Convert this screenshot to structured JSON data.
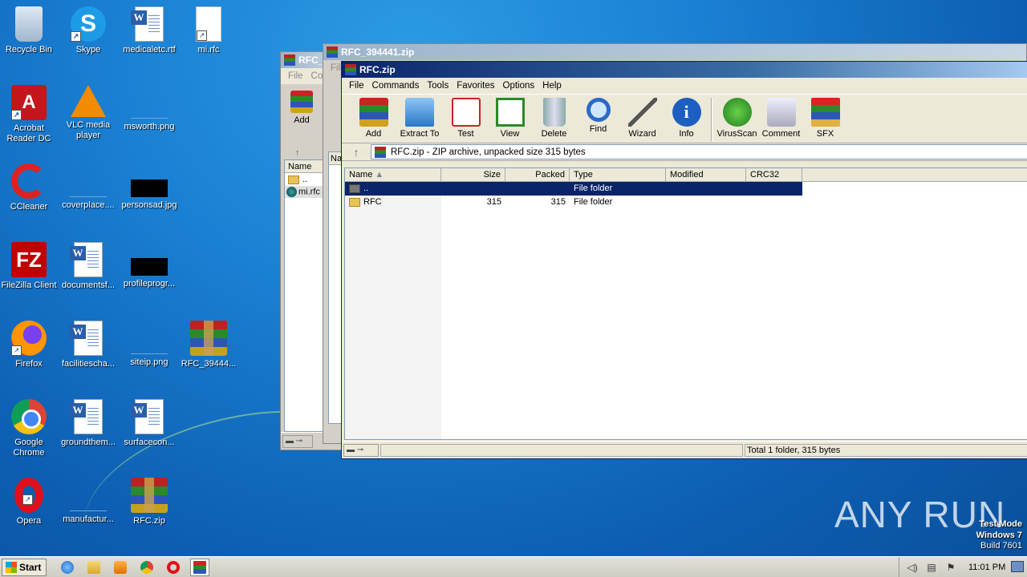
{
  "desktop": {
    "icons": [
      {
        "label": "Recycle Bin",
        "icon": "recycle-bin-icon"
      },
      {
        "label": "Skype",
        "icon": "skype-icon"
      },
      {
        "label": "medicaletc.rtf",
        "icon": "word-doc-icon"
      },
      {
        "label": "mi.rfc",
        "icon": "blank-file-icon"
      },
      {
        "label": "Acrobat Reader DC",
        "icon": "acrobat-icon"
      },
      {
        "label": "VLC media player",
        "icon": "vlc-icon"
      },
      {
        "label": "msworth.png",
        "icon": "png-file-icon"
      },
      {
        "label": "CCleaner",
        "icon": "ccleaner-icon"
      },
      {
        "label": "coverplace....",
        "icon": "png-file-icon"
      },
      {
        "label": "personsad.jpg",
        "icon": "jpg-file-icon"
      },
      {
        "label": "FileZilla Client",
        "icon": "filezilla-icon"
      },
      {
        "label": "documentsf...",
        "icon": "word-doc-icon"
      },
      {
        "label": "profileprogr...",
        "icon": "jpg-file-icon"
      },
      {
        "label": "Firefox",
        "icon": "firefox-icon"
      },
      {
        "label": "facilitiescha...",
        "icon": "word-doc-icon"
      },
      {
        "label": "siteip.png",
        "icon": "png-file-icon"
      },
      {
        "label": "RFC_39444...",
        "icon": "winrar-archive-icon"
      },
      {
        "label": "Google Chrome",
        "icon": "chrome-icon"
      },
      {
        "label": "groundthem...",
        "icon": "word-doc-icon"
      },
      {
        "label": "surfacecon...",
        "icon": "word-doc-icon"
      },
      {
        "label": "Opera",
        "icon": "opera-icon"
      },
      {
        "label": "manufactur...",
        "icon": "png-file-icon"
      },
      {
        "label": "RFC.zip",
        "icon": "winrar-archive-icon"
      }
    ]
  },
  "back_window_1": {
    "title": "RFC_...",
    "menu_file": "File",
    "menu_commands": "Co",
    "add_label": "Add",
    "col_name": "Name",
    "row_up": "..",
    "row_file": "mi.rfc"
  },
  "back_window_2": {
    "title": "RFC_394441.zip",
    "menu_file": "File",
    "col_name": "Na"
  },
  "main_window": {
    "title": "RFC.zip",
    "menu": [
      "File",
      "Commands",
      "Tools",
      "Favorites",
      "Options",
      "Help"
    ],
    "toolbar": [
      {
        "label": "Add",
        "icon": "add-archive-icon"
      },
      {
        "label": "Extract To",
        "icon": "extract-icon"
      },
      {
        "label": "Test",
        "icon": "test-icon"
      },
      {
        "label": "View",
        "icon": "view-icon"
      },
      {
        "label": "Delete",
        "icon": "delete-icon"
      },
      {
        "label": "Find",
        "icon": "find-icon"
      },
      {
        "label": "Wizard",
        "icon": "wizard-icon"
      },
      {
        "label": "Info",
        "icon": "info-icon"
      },
      {
        "label": "VirusScan",
        "icon": "virusscan-icon"
      },
      {
        "label": "Comment",
        "icon": "comment-icon"
      },
      {
        "label": "SFX",
        "icon": "sfx-icon"
      }
    ],
    "address": "RFC.zip - ZIP archive, unpacked size 315 bytes",
    "columns": {
      "name": "Name",
      "size": "Size",
      "packed": "Packed",
      "type": "Type",
      "modified": "Modified",
      "crc": "CRC32"
    },
    "rows": [
      {
        "name": "..",
        "size": "",
        "packed": "",
        "type": "File folder",
        "modified": "",
        "crc": ""
      },
      {
        "name": "RFC",
        "size": "315",
        "packed": "315",
        "type": "File folder",
        "modified": "",
        "crc": ""
      }
    ],
    "status": "Total 1 folder, 315 bytes"
  },
  "taskbar": {
    "start_label": "Start",
    "clock": "11:01 PM"
  },
  "watermark": "ANY RUN",
  "testmode": {
    "line1": "Test Mode",
    "line2": "Windows 7",
    "line3": "Build 7601"
  }
}
